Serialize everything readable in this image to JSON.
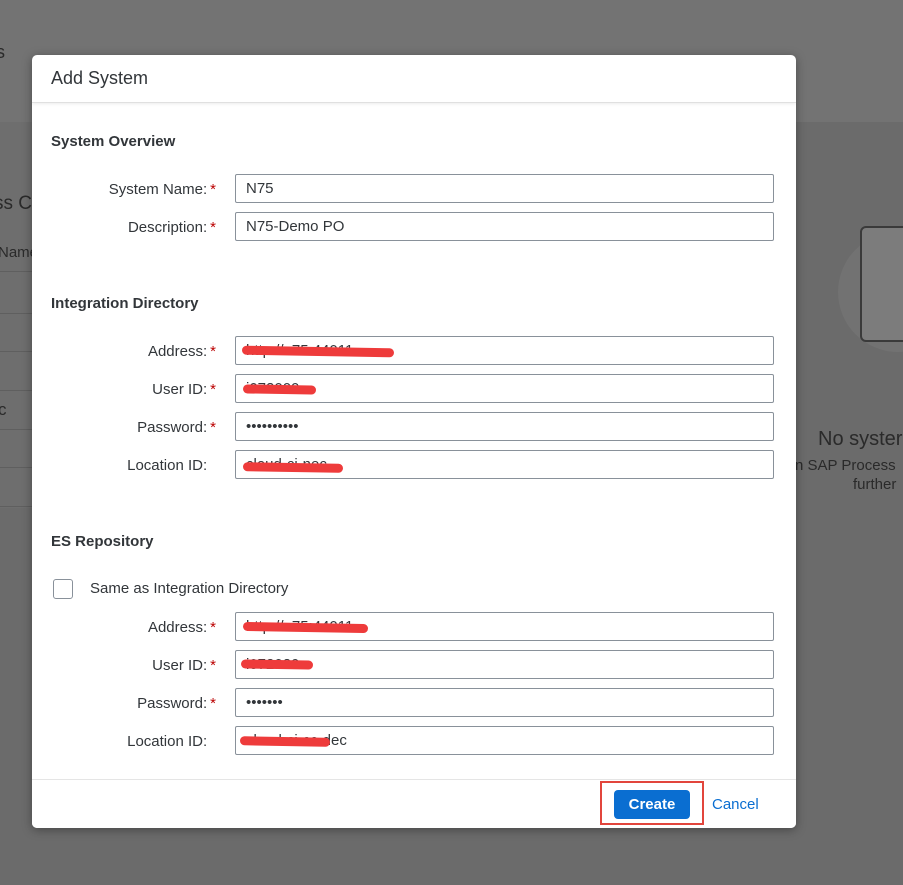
{
  "background": {
    "left_fragments": [
      "s",
      "ss C",
      "Name",
      "c"
    ],
    "empty_title": "No syster",
    "empty_text_1": "n SAP Process",
    "empty_text_2": "further"
  },
  "dialog": {
    "title": "Add System",
    "system_overview": {
      "title": "System Overview",
      "system_name_label": "System Name:",
      "system_name_value": "N75",
      "description_label": "Description:",
      "description_value": "N75-Demo PO"
    },
    "integration_directory": {
      "title": "Integration Directory",
      "address_label": "Address:",
      "address_value": "http://n75:44011",
      "user_id_label": "User ID:",
      "user_id_value": "i072000",
      "password_label": "Password:",
      "password_value": "••••••••••",
      "location_id_label": "Location ID:",
      "location_id_value": "cloud-ci-nec"
    },
    "es_repository": {
      "title": "ES Repository",
      "same_as_label": "Same as Integration Directory",
      "same_as_checked": false,
      "address_label": "Address:",
      "address_value": "http://n75:44011",
      "user_id_label": "User ID:",
      "user_id_value": "i072020",
      "password_label": "Password:",
      "password_value": "•••••••",
      "location_id_label": "Location ID:",
      "location_id_value": "cloud-ci-cc-dec"
    },
    "required_marker": "*",
    "create_label": "Create",
    "cancel_label": "Cancel"
  },
  "colors": {
    "accent": "#0a6ed1",
    "required": "#bb0000",
    "redaction": "#ee3b3b",
    "highlight": "#e2453c"
  }
}
